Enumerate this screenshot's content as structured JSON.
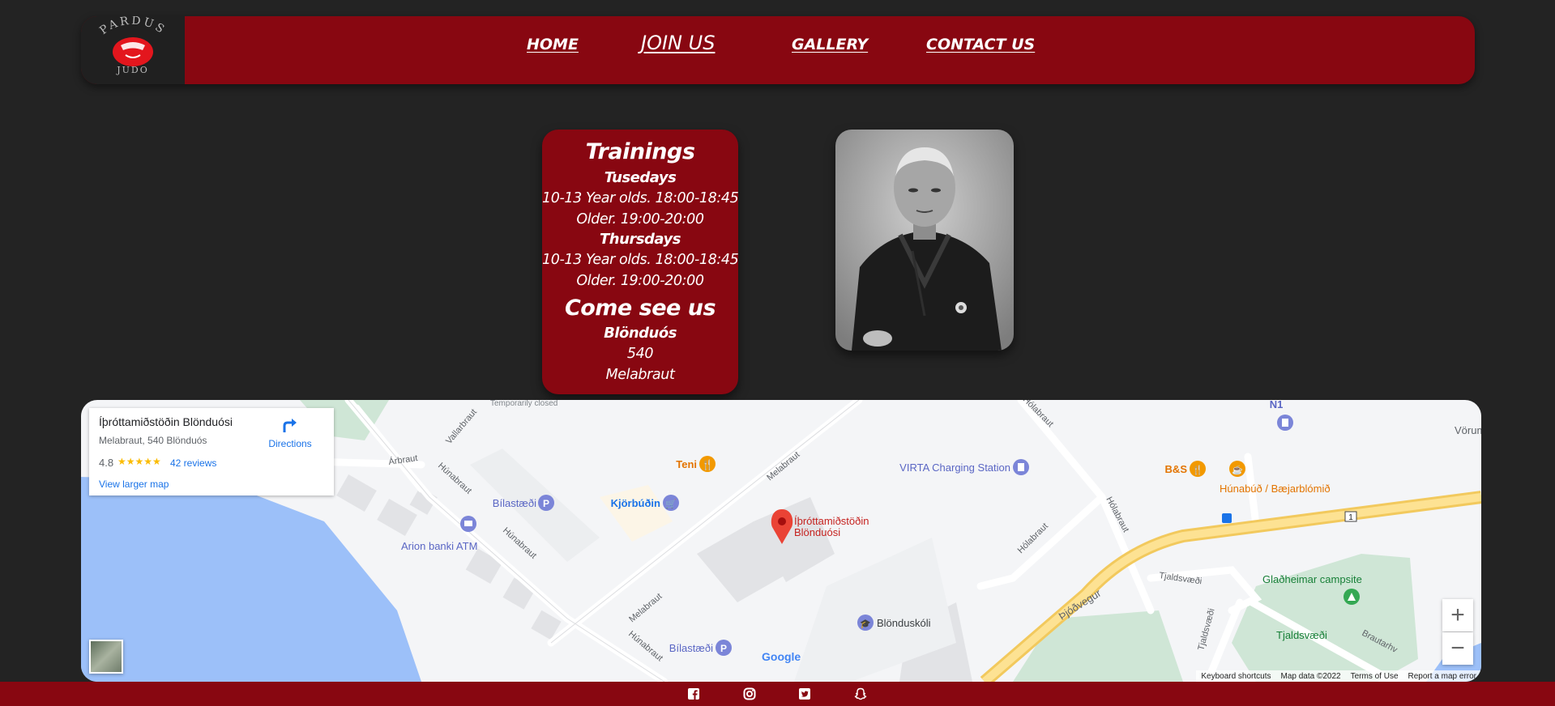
{
  "logo": {
    "top_text": "PARDUS",
    "bottom_text": "JUDO"
  },
  "nav": {
    "home": "HOME",
    "join": "JOIN US",
    "gallery": "GALLERY",
    "contact": "CONTACT US"
  },
  "trainings": {
    "title": "Trainings",
    "day1": "Tusedays",
    "day1_line1": "10-13 Year olds. 18:00-18:45",
    "day1_line2": "Older. 19:00-20:00",
    "day2": "Thursdays",
    "day2_line1": "10-13 Year olds. 18:00-18:45",
    "day2_line2": "Older. 19:00-20:00",
    "come_title": "Come see us",
    "town": "Blönduós",
    "postcode": "540",
    "street": "Melabraut"
  },
  "map": {
    "place_name": "Íþróttamiðstöðin Blönduósi",
    "address": "Melabraut, 540 Blönduós",
    "rating": "4.8",
    "stars": "★★★★★",
    "reviews": "42 reviews",
    "larger_map": "View larger map",
    "directions": "Directions",
    "temporarily_closed": "Temporarily closed",
    "pin_label_1": "Íþróttamiðstöðin",
    "pin_label_2": "Blönduósi",
    "labels": {
      "teni": "Teni",
      "virta": "VIRTA Charging Station",
      "bs": "B&S",
      "hunabud": "Húnabúð / Bæjarblómið",
      "vorum": "Vörum",
      "n1": "N1",
      "bilastaedi": "Bílastæði",
      "kjorbudin": "Kjörbúðin",
      "arion": "Arion banki ATM",
      "bilastaedi2": "Bílastæði",
      "blonduskoli": "Blönduskóli",
      "gladheimar": "Glaðheimar campsite",
      "tjaldsvaedi": "Tjaldsvæði",
      "arbraut": "Árbraut",
      "vallarbraut": "Vallarbraut",
      "hunabraut": "Húnabraut",
      "melabraut": "Melabraut",
      "holabraut": "Hólabraut",
      "thjodvegur": "Þjóðvegur",
      "tjaldsvaedi_road": "Tjaldsvæði",
      "brautarhv": "Brautarhv",
      "route": "1",
      "google": "Google"
    },
    "zoom_in": "+",
    "zoom_out": "−",
    "attribution": {
      "shortcuts": "Keyboard shortcuts",
      "data": "Map data ©2022",
      "terms": "Terms of Use",
      "report": "Report a map error"
    }
  },
  "colors": {
    "accent": "#880711",
    "background": "#232323"
  },
  "social_icons": [
    "facebook-icon",
    "instagram-icon",
    "twitter-icon",
    "snapchat-icon"
  ]
}
